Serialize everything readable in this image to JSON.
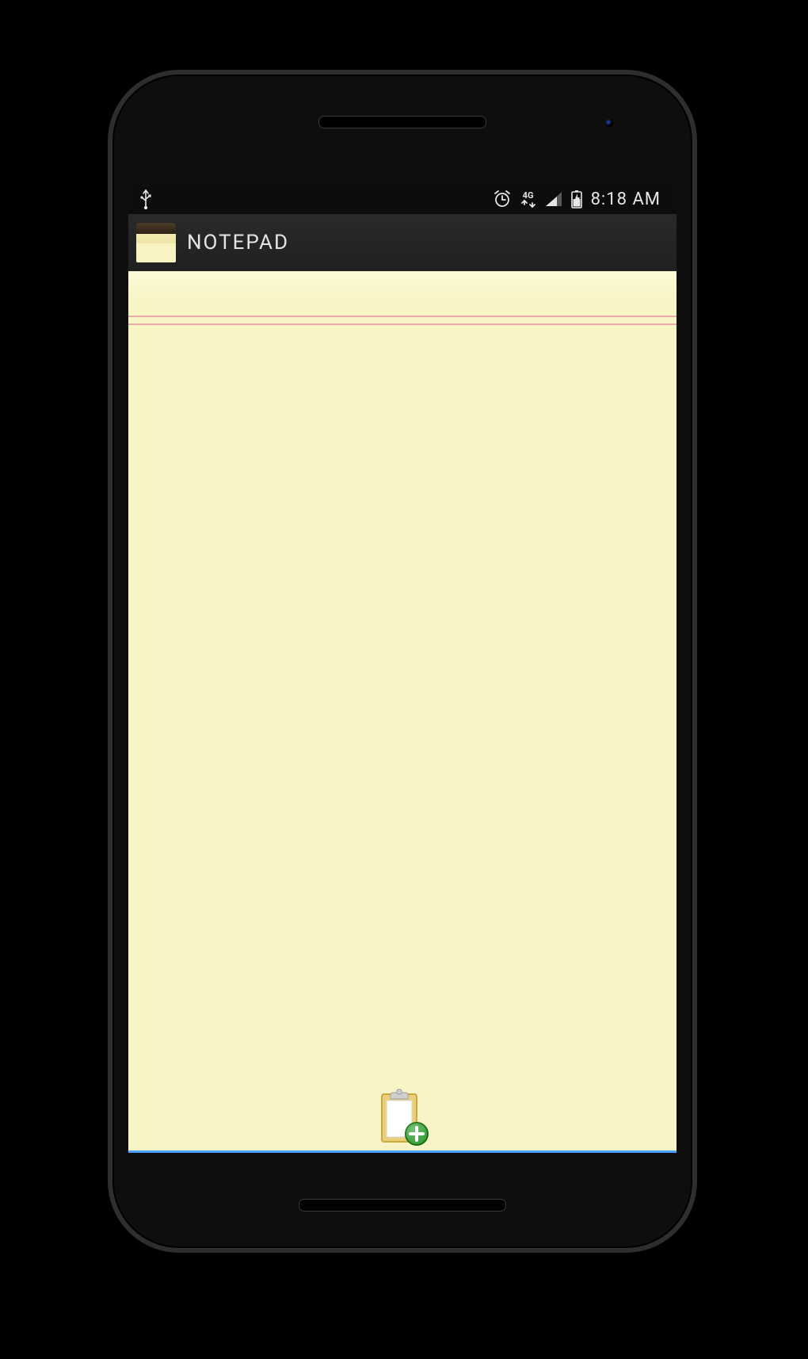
{
  "statusbar": {
    "network_label": "4G",
    "time": "8:18 AM"
  },
  "app": {
    "title": "NOTEPAD"
  },
  "icons": {
    "usb": "usb-icon",
    "alarm": "alarm-icon",
    "network_type": "network-4g-icon",
    "signal": "signal-icon",
    "battery": "battery-charging-icon",
    "app": "notepad-app-icon",
    "add_note": "clipboard-add-icon"
  }
}
